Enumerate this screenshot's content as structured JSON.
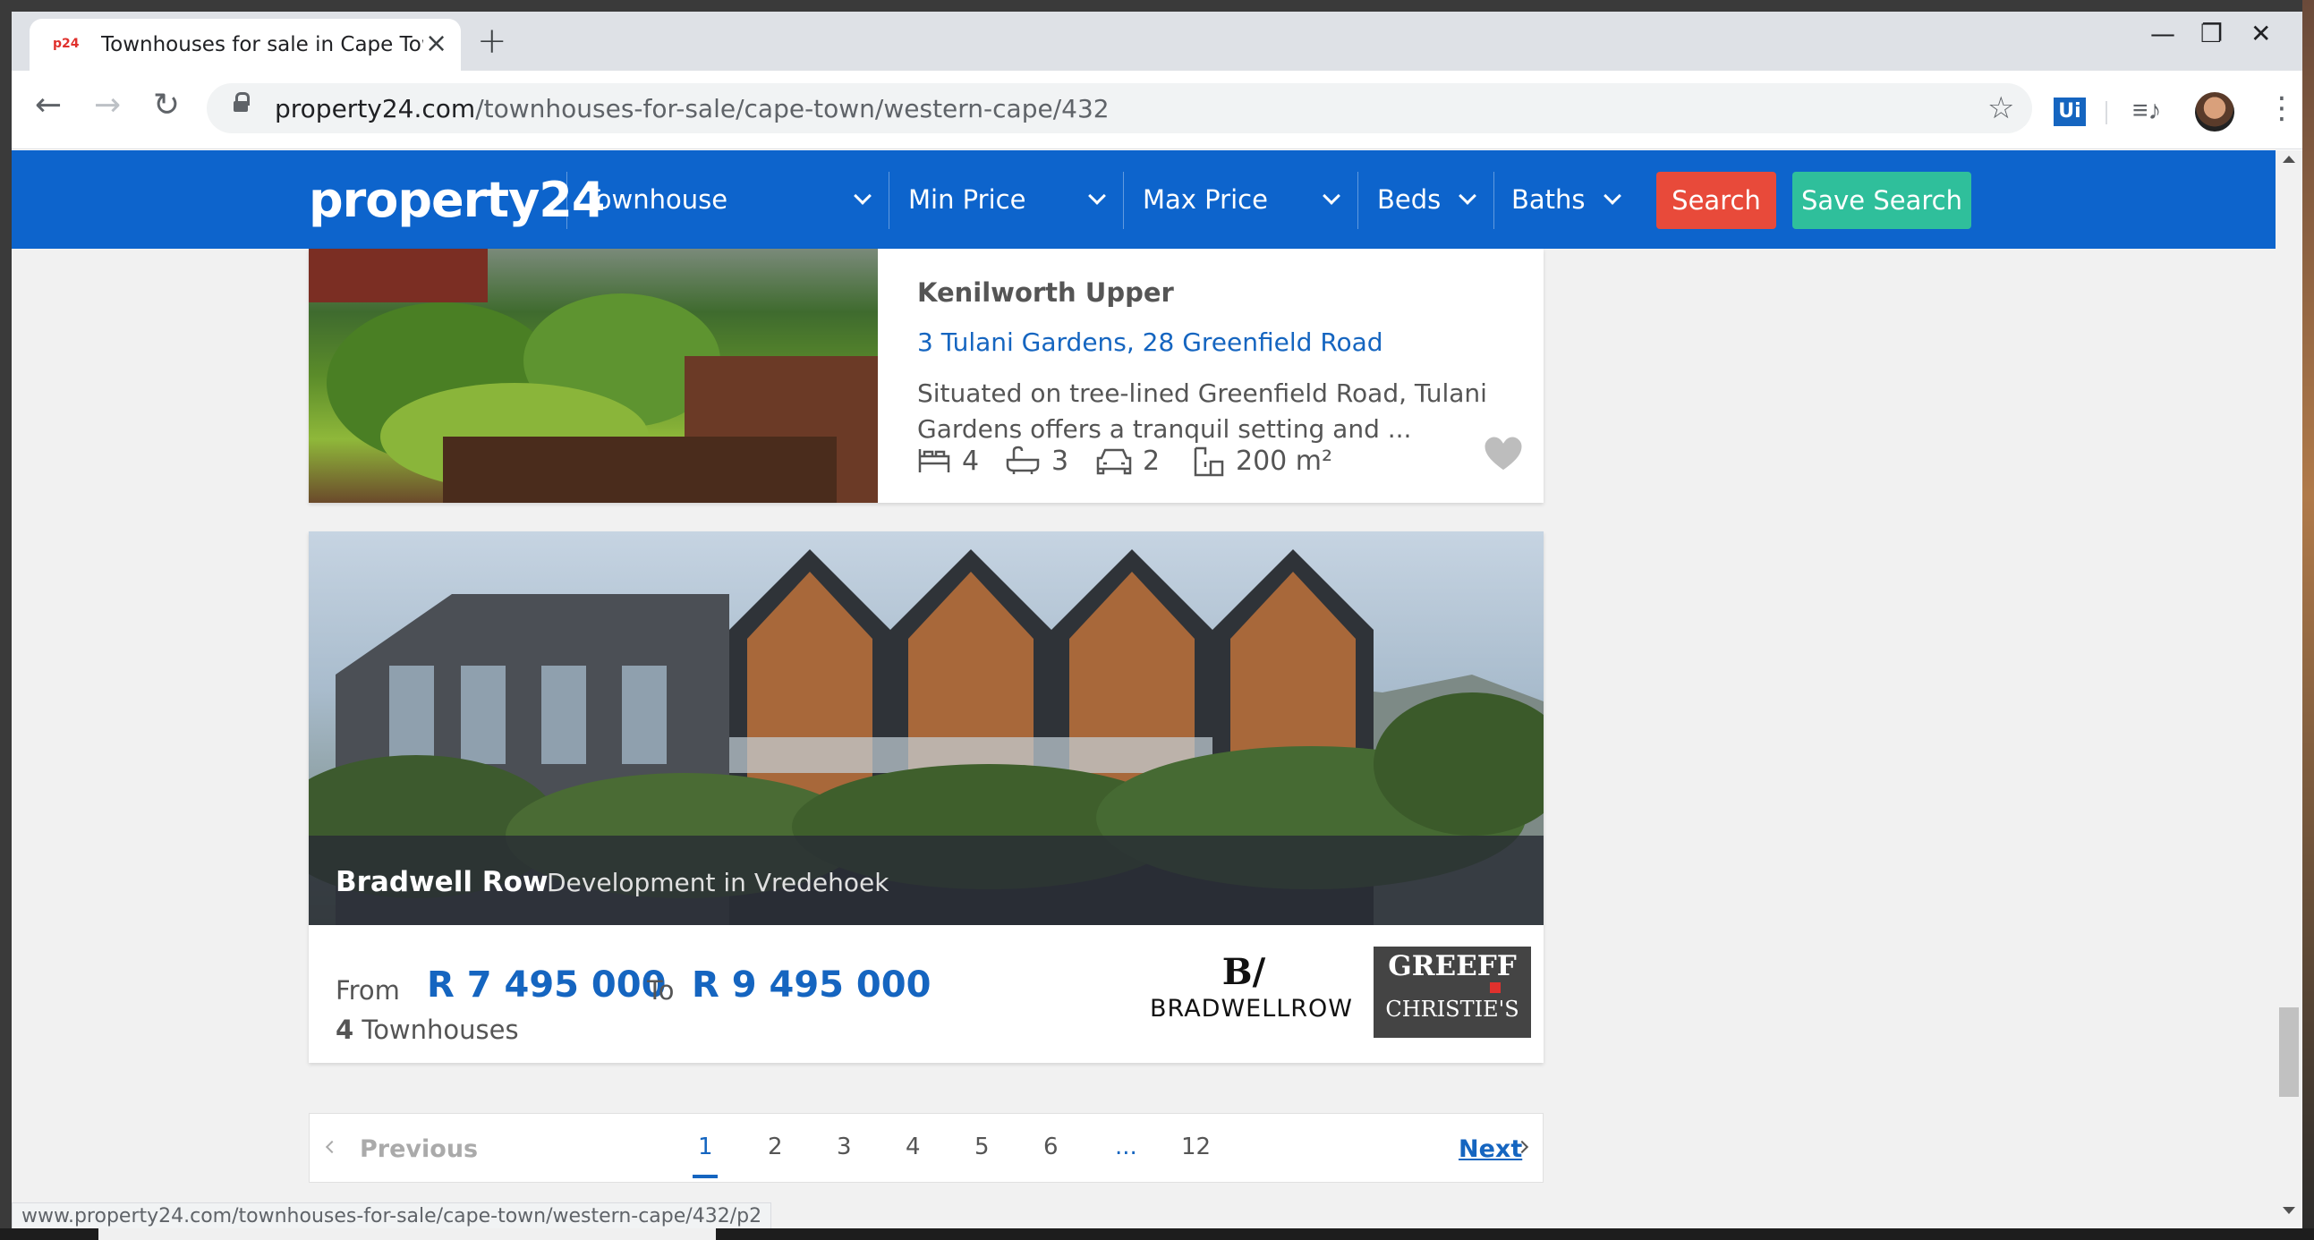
{
  "browser": {
    "tab_title": "Townhouses for sale in Cape Town",
    "favicon_text": "p24",
    "url_host": "property24.com",
    "url_path": "/townhouses-for-sale/cape-town/western-cape/432",
    "extension_label": "Ui",
    "status_url": "www.property24.com/townhouses-for-sale/cape-town/western-cape/432/p2"
  },
  "header": {
    "logo": "property24",
    "property_type": "Townhouse",
    "min_price": "Min Price",
    "max_price": "Max Price",
    "beds": "Beds",
    "baths": "Baths",
    "search_label": "Search",
    "save_search_label": "Save Search",
    "accent_color": "#0d64cc",
    "search_color": "#e84a3a",
    "save_color": "#2fbf9b"
  },
  "listing": {
    "suburb": "Kenilworth Upper",
    "address": "3 Tulani Gardens, 28 Greenfield Road",
    "description": "Situated on tree-lined Greenfield Road, Tulani Gardens offers a tranquil setting and ...",
    "bedrooms": "4",
    "bathrooms": "3",
    "parking": "2",
    "floor_size": "200 m²"
  },
  "development": {
    "name": "Bradwell Row",
    "location": "Development in Vredehoek",
    "from_label": "From",
    "price_from": "R 7 495 000",
    "to_label": "To",
    "price_to": "R 9 495 000",
    "unit_count": "4",
    "unit_label": "Townhouses",
    "developer_logo_text": "BRADWELLROW",
    "agent_logo_top": "GREEFF",
    "agent_logo_bottom": "CHRISTIE'S"
  },
  "pagination": {
    "previous": "Previous",
    "pages": [
      "1",
      "2",
      "3",
      "4",
      "5",
      "6",
      "...",
      "12"
    ],
    "active_page": "1",
    "next": "Next"
  }
}
